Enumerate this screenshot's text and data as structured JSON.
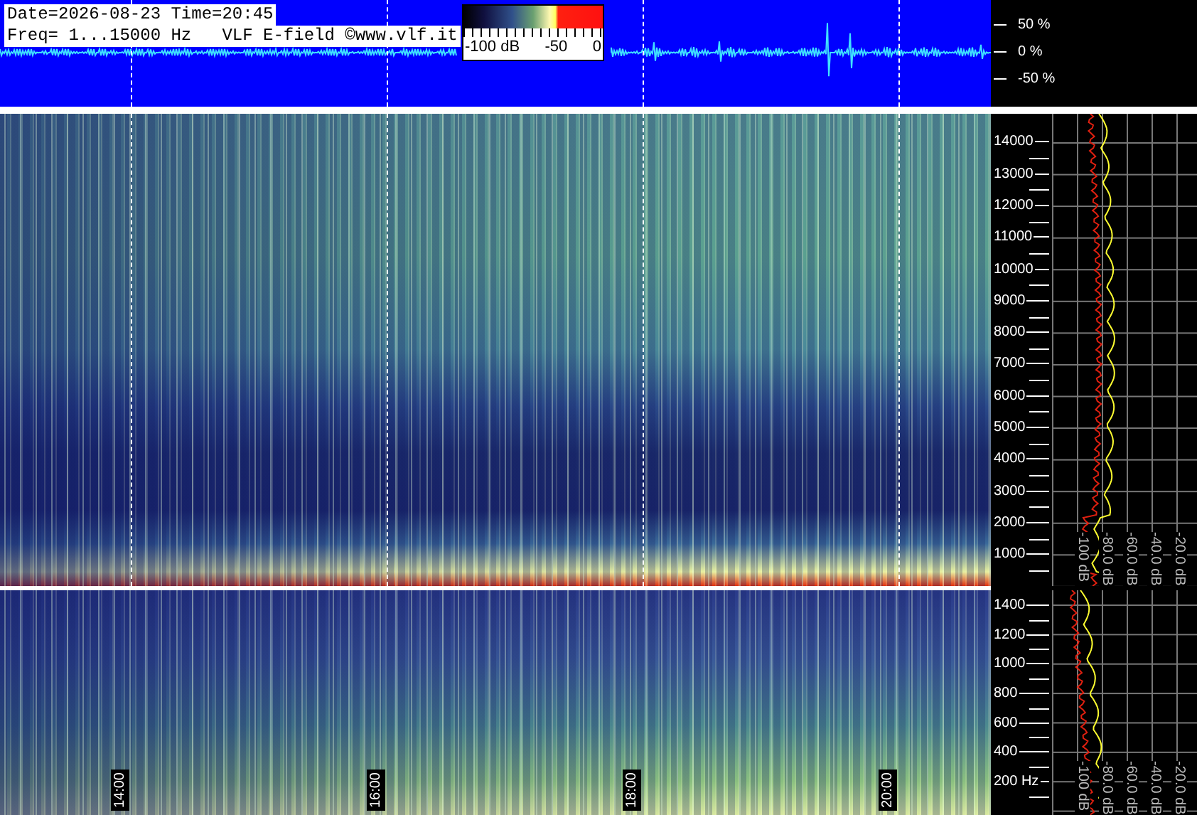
{
  "header": {
    "date_line": "Date=2026-08-23 Time=20:45",
    "freq_line": "Freq= 1...15000 Hz   VLF E-field ©www.vlf.it"
  },
  "colorbar": {
    "labels": [
      "-100 dB",
      "-50",
      "0"
    ]
  },
  "amplitude_axis": {
    "labels": [
      "50 %",
      "0 %",
      "-50 %"
    ]
  },
  "upper_panel": {
    "frequency_labels": [
      "14000",
      "13000",
      "12000",
      "11000",
      "10000",
      "9000",
      "8000",
      "7000",
      "6000",
      "5000",
      "4000",
      "3000",
      "2000",
      "1000"
    ],
    "db_labels": [
      "-100 dB",
      "-80.0 dB",
      "-60.0 dB",
      "-40.0 dB",
      "-20.0 dB"
    ]
  },
  "lower_panel": {
    "frequency_labels": [
      "1400",
      "1200",
      "1000",
      "800",
      "600",
      "400",
      "200 Hz"
    ],
    "db_labels": [
      "-100 dB",
      "-80.0 dB",
      "-60.0 dB",
      "-40.0 dB",
      "-20.0 dB"
    ]
  },
  "time_labels": [
    "14:00",
    "16:00",
    "18:00",
    "20:00"
  ]
}
